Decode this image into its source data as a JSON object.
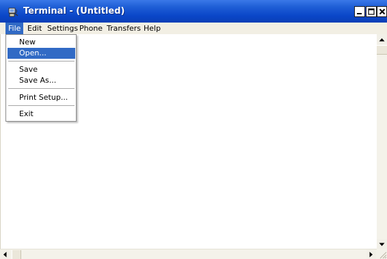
{
  "window": {
    "title": "Terminal - (Untitled)",
    "controls": [
      "minimize-icon",
      "maximize-icon",
      "close-icon"
    ]
  },
  "menubar": {
    "items": [
      {
        "label": "File",
        "active": true
      },
      {
        "label": "Edit"
      },
      {
        "label": "Settings"
      },
      {
        "label": "Phone"
      },
      {
        "label": "Transfers"
      },
      {
        "label": "Help"
      }
    ]
  },
  "file_menu": {
    "items": [
      {
        "label": "New"
      },
      {
        "label": "Open...",
        "highlighted": true
      },
      {
        "label": "Save"
      },
      {
        "label": "Save As..."
      },
      {
        "label": "Print Setup..."
      },
      {
        "label": "Exit"
      }
    ]
  },
  "colors": {
    "titlebar": "#0a46c8",
    "menu_highlight": "#316ac5",
    "menubar_bg": "#f2efe4"
  }
}
